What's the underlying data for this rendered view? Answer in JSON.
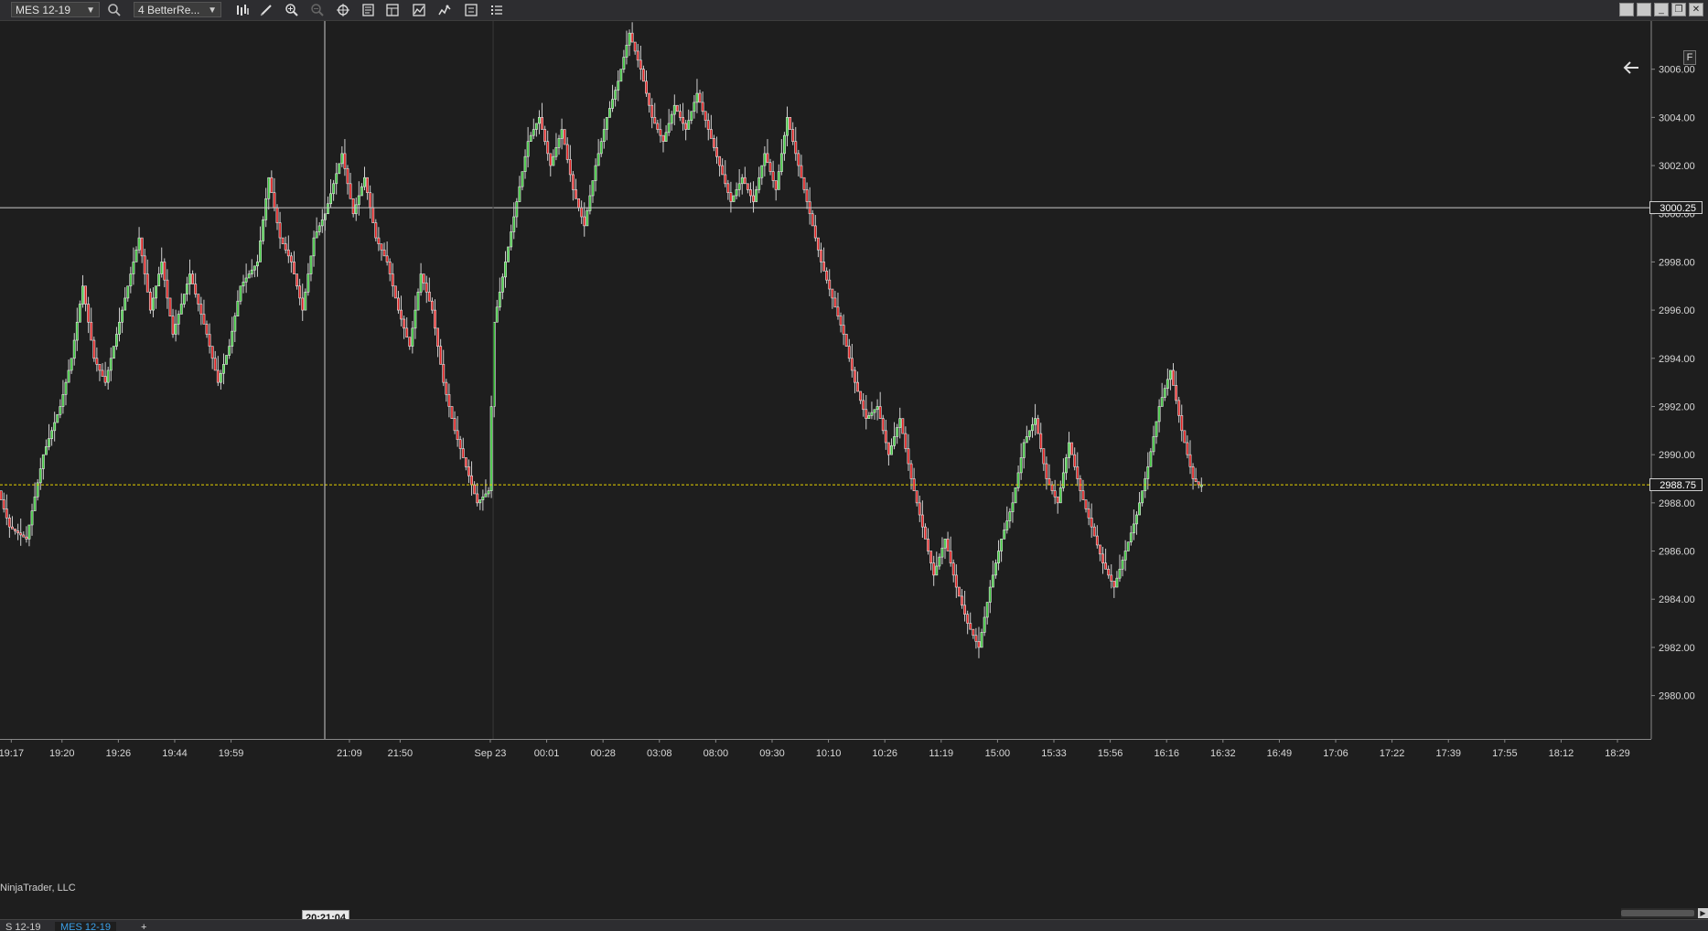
{
  "toolbar": {
    "instrument": "MES 12-19",
    "bar_type": "4 BetterRe...",
    "icons": [
      "search-icon",
      "bar-style-icon",
      "draw-pencil-icon",
      "zoom-in-icon",
      "zoom-out-icon",
      "crosshair-icon",
      "properties-icon",
      "templates-icon",
      "strategy-icon",
      "indicators-icon",
      "data-box-icon",
      "list-icon"
    ]
  },
  "window_buttons": [
    "tile-icon",
    "tile-icon",
    "minimize-icon",
    "restore-icon",
    "close-icon"
  ],
  "chart": {
    "crosshair_price": "3000.25",
    "last_price": "2988.75",
    "crosshair_time": "20:21:04",
    "watermark": "NinjaTrader, LLC",
    "f_button": "F",
    "colors": {
      "background": "#1e1e1e",
      "up": "#3fc83f",
      "down": "#e02020",
      "last_line": "#e8d400",
      "crosshair": "#c8c8c8"
    }
  },
  "chart_data": {
    "type": "bar",
    "chart_subtype": "candlestick (renko-style bricks)",
    "y_ticks": [
      "3006.00",
      "3004.00",
      "3002.00",
      "3000.00",
      "2998.00",
      "2996.00",
      "2994.00",
      "2992.00",
      "2990.00",
      "2988.00",
      "2986.00",
      "2984.00",
      "2982.00",
      "2980.00"
    ],
    "ylim": [
      2978.2,
      3008.0
    ],
    "x_ticks": [
      {
        "label": "19:17",
        "bar": 2
      },
      {
        "label": "19:20",
        "bar": 11
      },
      {
        "label": "19:26",
        "bar": 21
      },
      {
        "label": "19:44",
        "bar": 31
      },
      {
        "label": "19:59",
        "bar": 41
      },
      {
        "label": "21:09",
        "bar": 62
      },
      {
        "label": "21:50",
        "bar": 71
      },
      {
        "label": "Sep 23",
        "bar": 87
      },
      {
        "label": "00:01",
        "bar": 97
      },
      {
        "label": "00:28",
        "bar": 107
      },
      {
        "label": "03:08",
        "bar": 117
      },
      {
        "label": "08:00",
        "bar": 127
      },
      {
        "label": "09:30",
        "bar": 137
      },
      {
        "label": "10:10",
        "bar": 147
      },
      {
        "label": "10:26",
        "bar": 157
      },
      {
        "label": "11:19",
        "bar": 167
      },
      {
        "label": "15:00",
        "bar": 177
      },
      {
        "label": "15:33",
        "bar": 187
      },
      {
        "label": "15:56",
        "bar": 197
      },
      {
        "label": "16:16",
        "bar": 207
      },
      {
        "label": "16:32",
        "bar": 217
      },
      {
        "label": "16:49",
        "bar": 227
      },
      {
        "label": "17:06",
        "bar": 237
      },
      {
        "label": "17:22",
        "bar": 247
      },
      {
        "label": "17:39",
        "bar": 257
      },
      {
        "label": "17:55",
        "bar": 267
      },
      {
        "label": "18:12",
        "bar": 277
      },
      {
        "label": "18:29",
        "bar": 287
      }
    ],
    "bar_count_visible": 293,
    "path_points": [
      [
        0,
        2988.5
      ],
      [
        2,
        2987.0
      ],
      [
        5,
        2986.5
      ],
      [
        8,
        2990.0
      ],
      [
        11,
        2992.0
      ],
      [
        13,
        2994.0
      ],
      [
        15,
        2997.0
      ],
      [
        17,
        2994.0
      ],
      [
        19,
        2993.0
      ],
      [
        22,
        2996.0
      ],
      [
        25,
        2999.0
      ],
      [
        27,
        2996.0
      ],
      [
        29,
        2998.0
      ],
      [
        31,
        2995.0
      ],
      [
        34,
        2997.5
      ],
      [
        37,
        2995.0
      ],
      [
        39,
        2993.0
      ],
      [
        41,
        2994.5
      ],
      [
        43,
        2997.0
      ],
      [
        46,
        2998.0
      ],
      [
        48,
        3001.5
      ],
      [
        50,
        2999.0
      ],
      [
        52,
        2998.0
      ],
      [
        54,
        2996.0
      ],
      [
        56,
        2999.0
      ],
      [
        58,
        3000.0
      ],
      [
        61,
        3002.5
      ],
      [
        63,
        3000.0
      ],
      [
        65,
        3001.5
      ],
      [
        67,
        2999.0
      ],
      [
        69,
        2998.0
      ],
      [
        71,
        2996.0
      ],
      [
        73,
        2994.5
      ],
      [
        75,
        2997.5
      ],
      [
        77,
        2996.0
      ],
      [
        79,
        2993.0
      ],
      [
        81,
        2991.0
      ],
      [
        83,
        2989.5
      ],
      [
        85,
        2988.0
      ],
      [
        87,
        2988.5
      ],
      [
        88,
        2995.5
      ],
      [
        90,
        2998.0
      ],
      [
        92,
        3000.5
      ],
      [
        94,
        3003.0
      ],
      [
        96,
        3004.0
      ],
      [
        98,
        3002.0
      ],
      [
        100,
        3003.5
      ],
      [
        102,
        3001.0
      ],
      [
        104,
        2999.5
      ],
      [
        106,
        3002.0
      ],
      [
        108,
        3004.0
      ],
      [
        110,
        3005.5
      ],
      [
        112,
        3007.5
      ],
      [
        114,
        3006.0
      ],
      [
        116,
        3004.0
      ],
      [
        118,
        3003.0
      ],
      [
        120,
        3004.5
      ],
      [
        122,
        3003.5
      ],
      [
        124,
        3005.0
      ],
      [
        126,
        3003.5
      ],
      [
        128,
        3002.0
      ],
      [
        130,
        3000.5
      ],
      [
        132,
        3001.5
      ],
      [
        134,
        3000.5
      ],
      [
        136,
        3002.5
      ],
      [
        138,
        3001.0
      ],
      [
        140,
        3004.0
      ],
      [
        142,
        3002.0
      ],
      [
        144,
        3000.0
      ],
      [
        146,
        2998.0
      ],
      [
        148,
        2996.5
      ],
      [
        150,
        2995.0
      ],
      [
        152,
        2993.0
      ],
      [
        154,
        2991.5
      ],
      [
        156,
        2992.0
      ],
      [
        158,
        2990.0
      ],
      [
        160,
        2991.5
      ],
      [
        162,
        2989.0
      ],
      [
        164,
        2987.0
      ],
      [
        166,
        2985.0
      ],
      [
        168,
        2986.5
      ],
      [
        170,
        2984.5
      ],
      [
        172,
        2983.0
      ],
      [
        174,
        2982.0
      ],
      [
        176,
        2984.5
      ],
      [
        178,
        2986.5
      ],
      [
        180,
        2988.0
      ],
      [
        182,
        2990.5
      ],
      [
        184,
        2991.5
      ],
      [
        186,
        2989.0
      ],
      [
        188,
        2988.0
      ],
      [
        190,
        2990.5
      ],
      [
        192,
        2988.5
      ],
      [
        194,
        2987.0
      ],
      [
        196,
        2985.5
      ],
      [
        198,
        2984.5
      ],
      [
        200,
        2986.0
      ],
      [
        202,
        2987.5
      ],
      [
        204,
        2989.5
      ],
      [
        206,
        2992.0
      ],
      [
        208,
        2993.5
      ],
      [
        210,
        2991.0
      ],
      [
        212,
        2989.0
      ],
      [
        213,
        2988.75
      ]
    ]
  },
  "tabs": [
    "S 12-19",
    "MES 12-19",
    "+"
  ]
}
